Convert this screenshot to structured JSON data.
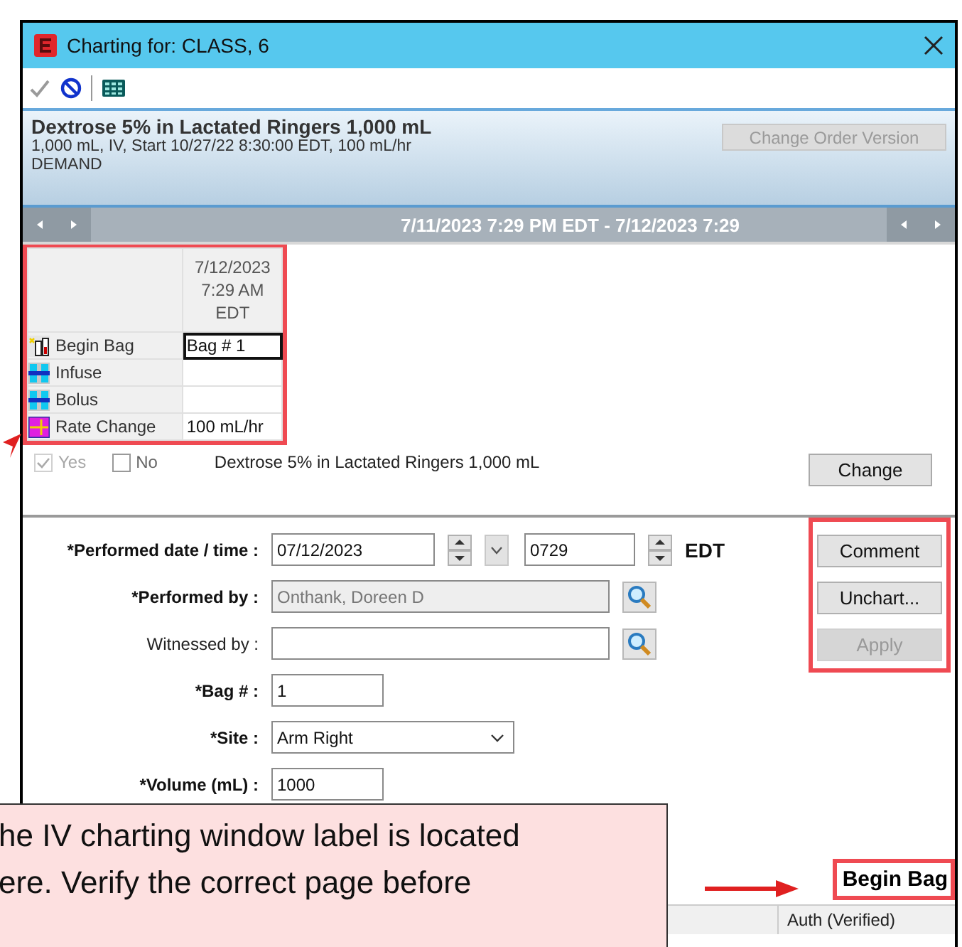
{
  "window": {
    "title": "Charting for: CLASS, 6"
  },
  "toolbar": [
    {
      "kind": "sign",
      "disabled": true
    },
    {
      "kind": "cancel",
      "disabled": false
    },
    {
      "kind": "calculator",
      "disabled": false
    }
  ],
  "order": {
    "name": "Dextrose 5% in Lactated Ringers 1,000 mL",
    "details": "1,000 mL, IV, Start 10/27/22 8:30:00 EDT, 100 mL/hr",
    "frequency": "DEMAND",
    "button": {
      "label": "Change Order Version",
      "disabled": true
    }
  },
  "range": "7/11/2023 7:29 PM EDT - 7/12/2023 7:29",
  "grid": {
    "column_heading": "7/12/2023 7:29 AM EDT",
    "rows": [
      {
        "kind": "begin",
        "label": "Begin Bag",
        "value": "Bag # 1",
        "selected": true
      },
      {
        "kind": "infuse",
        "label": "Infuse",
        "selected": false
      },
      {
        "kind": "infuse",
        "label": "Bolus",
        "selected": false
      },
      {
        "kind": "rate",
        "label": "Rate Change",
        "value": "100 mL/hr",
        "selected": false
      }
    ]
  },
  "confirm": {
    "options": [
      {
        "label": "Yes",
        "checked": true,
        "disabled": true
      },
      {
        "label": "No",
        "checked": false,
        "disabled": false
      }
    ],
    "description": "Dextrose 5% in Lactated Ringers 1,000 mL",
    "button": "Change"
  },
  "form": [
    {
      "kind": "datetime",
      "label": "*Performed date / time :",
      "required": true,
      "date": "07/12/2023",
      "time": "0729",
      "zone": "EDT"
    },
    {
      "kind": "lookup",
      "label": "*Performed by :",
      "required": true,
      "value": "Onthank, Doreen D",
      "disabled": true
    },
    {
      "kind": "lookup",
      "label": "Witnessed by :",
      "required": false,
      "disabled": false
    },
    {
      "kind": "text",
      "label": "*Bag # :",
      "required": true,
      "value": "1"
    },
    {
      "kind": "select",
      "label": "*Site :",
      "required": true,
      "value": "Arm Right"
    },
    {
      "kind": "text",
      "label": "*Volume (mL) :",
      "required": true,
      "value": "1000"
    }
  ],
  "actions": [
    {
      "label": "Comment",
      "disabled": false
    },
    {
      "label": "Unchart...",
      "disabled": false
    },
    {
      "label": "Apply",
      "disabled": true
    }
  ],
  "page_label": "Begin Bag",
  "status_bar": {
    "status": "Auth (Verified)"
  },
  "callout": {
    "lines": [
      "he IV charting window label is located",
      "ere. Verify the correct page before"
    ]
  }
}
